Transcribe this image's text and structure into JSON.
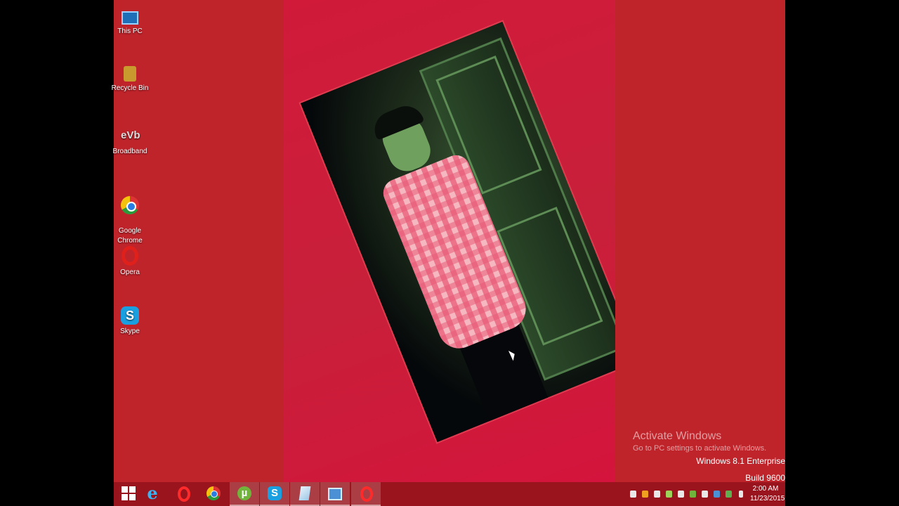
{
  "desktop": {
    "icons": [
      {
        "label": "This PC",
        "icon": "computer-icon"
      },
      {
        "label": "Recycle Bin",
        "icon": "recycle-bin-icon"
      },
      {
        "label": "Broadband",
        "icon": "broadband-icon"
      },
      {
        "label": "Google\nChrome",
        "icon": "chrome-icon"
      },
      {
        "label": "Opera",
        "icon": "opera-icon"
      },
      {
        "label": "Skype",
        "icon": "skype-icon"
      }
    ],
    "broadband_glyph": "eVb",
    "skype_glyph": "S",
    "accent": "#c0242b"
  },
  "watermark": {
    "title": "Activate Windows",
    "subtitle": "Go to PC settings to activate Windows.",
    "edition": "Windows 8.1 Enterprise",
    "build": "Build 9600"
  },
  "taskbar": {
    "buttons": [
      {
        "name": "start-button",
        "icon": "windows-logo-icon"
      },
      {
        "name": "internet-explorer",
        "icon": "internet-explorer-icon",
        "glyph": "e"
      },
      {
        "name": "opera-taskbar",
        "icon": "opera-icon"
      },
      {
        "name": "chrome-taskbar",
        "icon": "chrome-icon"
      },
      {
        "name": "utorrent-taskbar",
        "icon": "utorrent-icon",
        "glyph": "µ"
      },
      {
        "name": "skype-taskbar",
        "icon": "skype-icon",
        "glyph": "S"
      },
      {
        "name": "document-taskbar",
        "icon": "document-icon"
      },
      {
        "name": "network-taskbar",
        "icon": "network-icon"
      },
      {
        "name": "opera-taskbar-active",
        "icon": "opera-icon"
      }
    ],
    "clock": {
      "time": "2:00 AM",
      "date": "11/23/2015"
    }
  }
}
